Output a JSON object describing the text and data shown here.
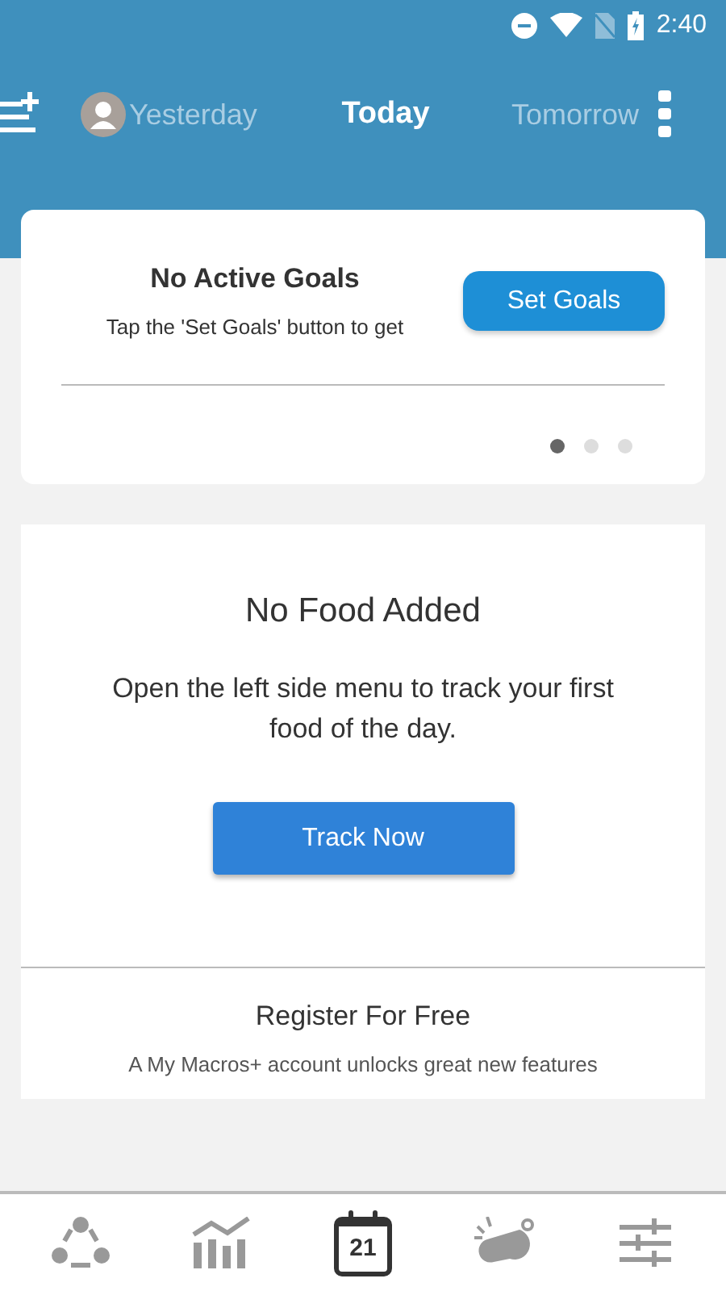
{
  "status_bar": {
    "time": "2:40"
  },
  "day_tabs": [
    {
      "label": "Yesterday",
      "selected": false
    },
    {
      "label": "Today",
      "selected": true
    },
    {
      "label": "Tomorrow",
      "selected": false
    }
  ],
  "goals_card": {
    "title": "No Active Goals",
    "text": "Tap the 'Set Goals' button to get",
    "button": "Set Goals",
    "pages": [
      {
        "selected": true
      },
      {
        "selected": false
      },
      {
        "selected": false
      }
    ]
  },
  "food_card": {
    "title": "No Food Added",
    "text": "Open the left side menu to track your first food of the day.",
    "button": "Track Now"
  },
  "register": {
    "title": "Register For Free",
    "text": "A My Macros+ account unlocks great new features"
  },
  "bottom_nav": [
    {
      "kind": "community",
      "selected": false
    },
    {
      "kind": "stats",
      "selected": false
    },
    {
      "kind": "calendar",
      "label": "21",
      "selected": true
    },
    {
      "kind": "whistle",
      "selected": false
    },
    {
      "kind": "settings",
      "selected": false
    }
  ]
}
